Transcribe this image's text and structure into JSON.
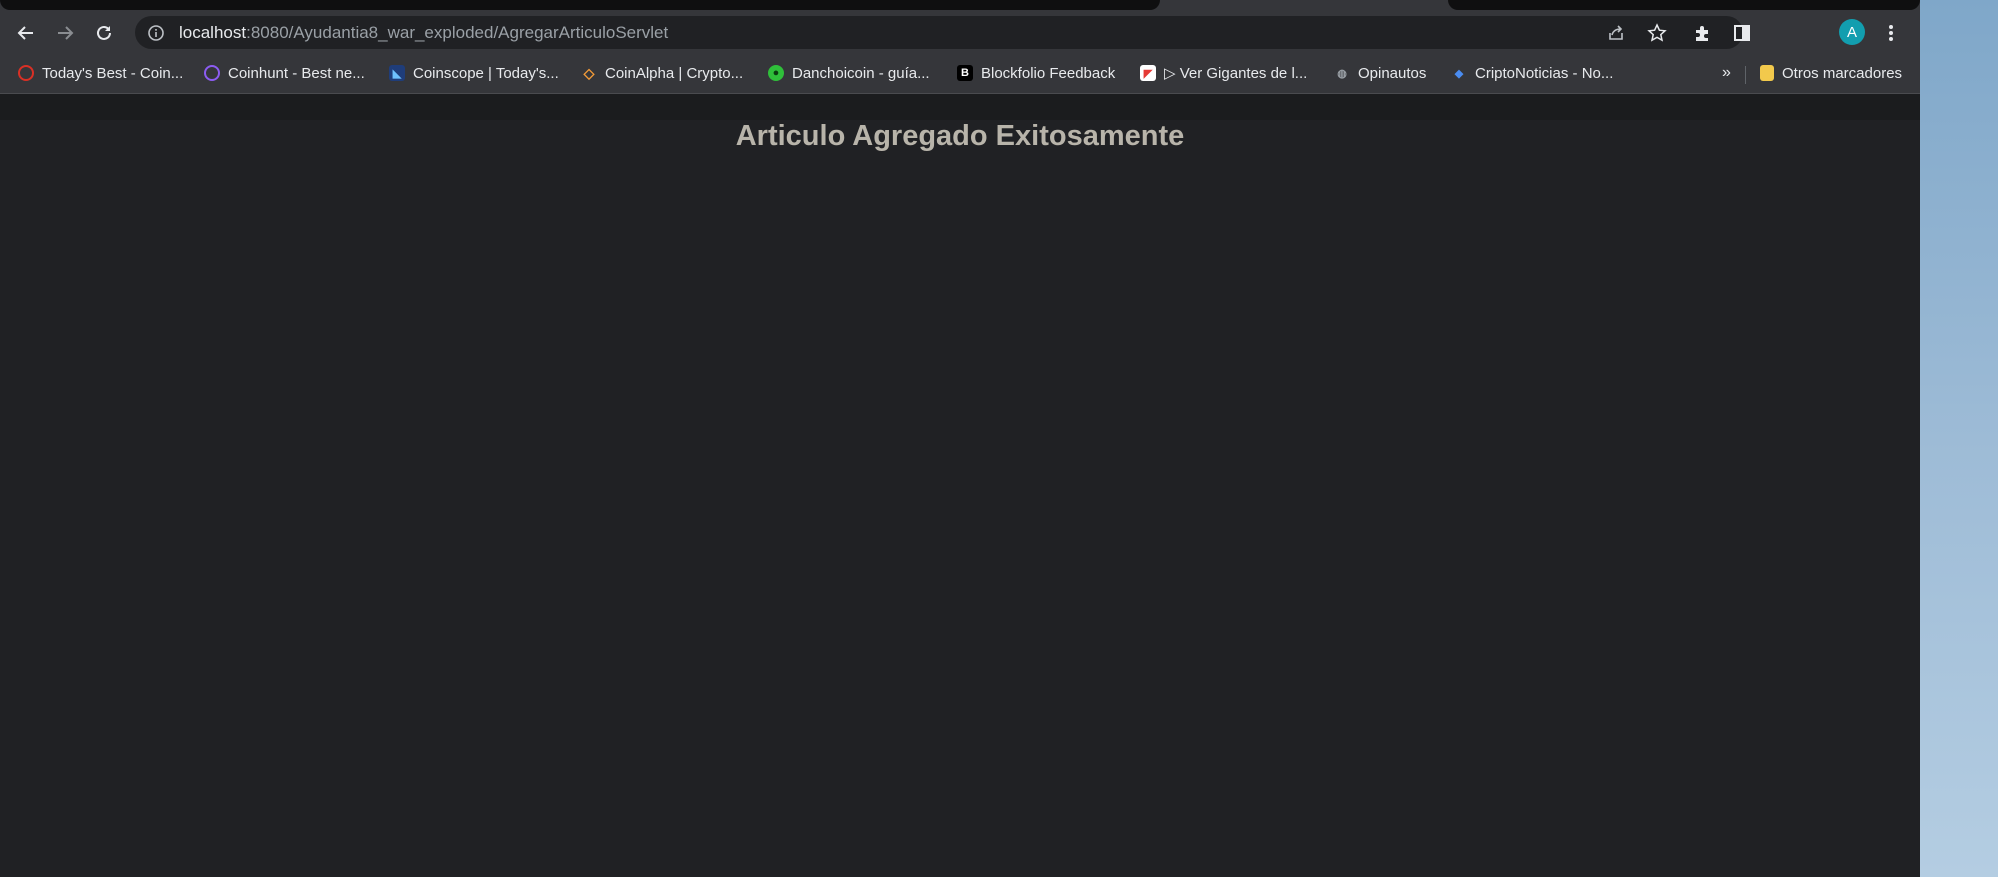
{
  "browser": {
    "url_host": "localhost",
    "url_path": ":8080/Ayudantia8_war_exploded/AgregarArticuloServlet",
    "profile_initial": "A"
  },
  "bookmarks": [
    {
      "label": "Today's Best - Coin...",
      "icon": "coin-red-icon",
      "color": "#d93025"
    },
    {
      "label": "Coinhunt - Best ne...",
      "icon": "coinhunt-icon",
      "color": "#8c5cf2"
    },
    {
      "label": "Coinscope | Today's...",
      "icon": "coinscope-icon",
      "color": "#3b6fd6"
    },
    {
      "label": "CoinAlpha | Crypto...",
      "icon": "coinalpha-icon",
      "color": "#f29b38"
    },
    {
      "label": "Danchoicoin - guía...",
      "icon": "danchoicoin-icon",
      "color": "#2fbf3a"
    },
    {
      "label": "Blockfolio Feedback",
      "icon": "blockfolio-icon",
      "color": "#000000",
      "glyph": "B"
    },
    {
      "label": "▷ Ver Gigantes de l...",
      "icon": "gigantes-icon",
      "color": "#e53935"
    },
    {
      "label": "Opinautos",
      "icon": "opinautos-icon",
      "color": "#5f6368"
    },
    {
      "label": "CriptoNoticias - No...",
      "icon": "criptonoticias-icon",
      "color": "#4a8cf0"
    }
  ],
  "bookmarks_overflow": "»",
  "other_bookmarks": {
    "label": "Otros marcadores",
    "icon": "folder-icon",
    "color": "#f2c94c"
  },
  "page": {
    "heading": "Articulo Agregado Exitosamente"
  }
}
